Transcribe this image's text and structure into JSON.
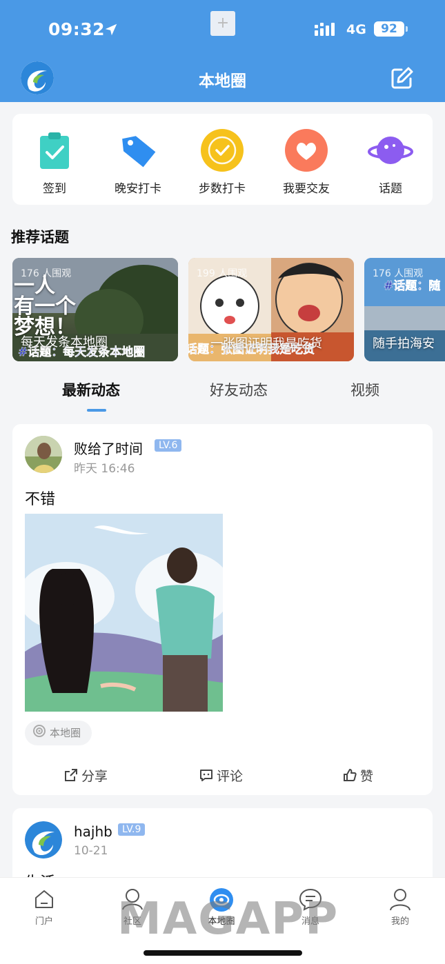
{
  "status_bar": {
    "time": "09:32",
    "network": "4G",
    "battery": "92"
  },
  "header": {
    "title": "本地圈"
  },
  "quick_actions": [
    {
      "label": "签到",
      "icon": "clipboard-check-icon"
    },
    {
      "label": "晚安打卡",
      "icon": "tag-icon"
    },
    {
      "label": "步数打卡",
      "icon": "check-circle-icon"
    },
    {
      "label": "我要交友",
      "icon": "heart-icon"
    },
    {
      "label": "话题",
      "icon": "planet-icon"
    }
  ],
  "topics_section": {
    "title": "推荐话题",
    "items": [
      {
        "views": "176 人围观",
        "name": "每天发条本地圈",
        "overlay_big": "一人\n有一个\n梦想！",
        "hashtag": "#话题：每天发条本地圈"
      },
      {
        "views": "199 人围观",
        "name": "一张图证明我是吃货",
        "hashtag": "话题：张图证明我是吃货"
      },
      {
        "views": "176 人围观",
        "name": "随手拍海安",
        "hashtag": "#话题：随"
      }
    ]
  },
  "feed_tabs": [
    {
      "label": "最新动态",
      "active": true
    },
    {
      "label": "好友动态",
      "active": false
    },
    {
      "label": "视频",
      "active": false
    }
  ],
  "posts": [
    {
      "username": "败给了时间",
      "level": "LV.6",
      "time": "昨天 16:46",
      "text": "不错",
      "location_tag": "本地圈",
      "actions": {
        "share": "分享",
        "comment": "评论",
        "like": "赞"
      }
    },
    {
      "username": "hajhb",
      "level": "LV.9",
      "time": "10-21",
      "text": "生活"
    }
  ],
  "bottom_nav": [
    {
      "label": "门户",
      "icon": "home-icon",
      "active": false
    },
    {
      "label": "社区",
      "icon": "community-icon",
      "active": false
    },
    {
      "label": "本地圈",
      "icon": "local-circle-icon",
      "active": true
    },
    {
      "label": "消息",
      "icon": "message-icon",
      "active": false
    },
    {
      "label": "我的",
      "icon": "profile-icon",
      "active": false
    }
  ],
  "watermark": "MAGAPP",
  "colors": {
    "primary": "#4a99e6",
    "level_badge": "#8fb7ef",
    "hashtag": "#1e2fb5"
  }
}
